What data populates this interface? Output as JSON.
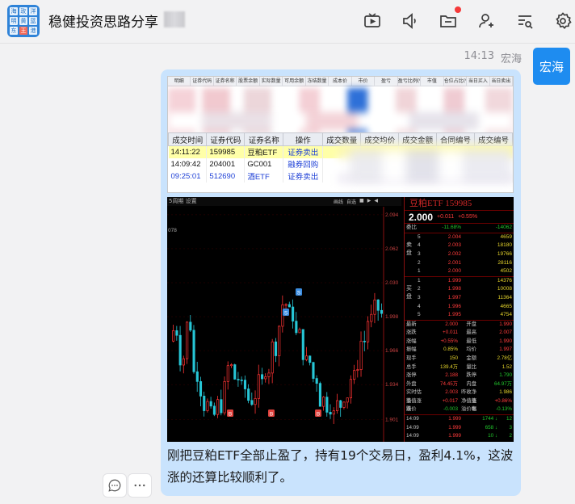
{
  "header": {
    "title": "稳健投资思路分享",
    "avatar_chars": [
      "海",
      "玫",
      "洋",
      "明",
      "黄",
      "蓝",
      "东",
      "王",
      "港"
    ]
  },
  "message": {
    "time": "14:13",
    "sender": "宏海",
    "sender_avatar_text": "宏海",
    "text": "刚把豆粕ETF全部止盈了，持有19个交易日，盈利4.1%，这波涨的还算比较顺利了。"
  },
  "terminal": {
    "top_headers": [
      "明细",
      "证券代码",
      "证券名称",
      "股票余额",
      "实际数量",
      "可用余额",
      "冻结数量",
      "成本价",
      "市价",
      "盈亏",
      "盈亏比例(%)",
      "市值",
      "仓位占比(%)",
      "当日买入",
      "当日卖出"
    ],
    "trade_headers": [
      "成交时间",
      "证券代码",
      "证券名称",
      "操作",
      "成交数量",
      "成交均价",
      "成交金额",
      "合同编号",
      "成交编号"
    ],
    "trades": [
      {
        "time": "14:11:22",
        "code": "159985",
        "name": "豆粕ETF",
        "op": "证券卖出"
      },
      {
        "time": "14:09:42",
        "code": "204001",
        "name": "GC001",
        "op": "融券回购"
      },
      {
        "time": "09:25:01",
        "code": "512690",
        "name": "酒ETF",
        "op": "证券卖出"
      }
    ]
  },
  "chart": {
    "topbar_left": "5周期 设置",
    "tools": [
      "画线",
      "自选",
      "■",
      "▶",
      "◀"
    ],
    "left_tick": "078",
    "ytick_labels": [
      "2.094",
      "2.062",
      "2.030",
      "1.998",
      "1.966",
      "1.934",
      "1.901"
    ],
    "markers": [
      "S",
      "S",
      "B",
      "B",
      "B"
    ]
  },
  "chart_data": {
    "type": "candlestick",
    "title": "",
    "ylim": [
      1.89,
      2.1
    ],
    "y_ticks": [
      2.094,
      2.062,
      2.03,
      1.998,
      1.966,
      1.934,
      1.901
    ]
  },
  "quote": {
    "title": "豆粕ETF 159985",
    "price": "2.000",
    "change": "+0.011",
    "change_pct": "+0.55%",
    "weibi_label": "委比",
    "weibi_value": "-11.68%",
    "weicha_value": "-14062",
    "ask_label": "卖盘",
    "bid_label": "买盘",
    "asks": [
      {
        "level": "5",
        "price": "2.004",
        "vol": "4659"
      },
      {
        "level": "4",
        "price": "2.003",
        "vol": "18180"
      },
      {
        "level": "3",
        "price": "2.002",
        "vol": "19766"
      },
      {
        "level": "2",
        "price": "2.001",
        "vol": "28116"
      },
      {
        "level": "1",
        "price": "2.000",
        "vol": "4502"
      }
    ],
    "bids": [
      {
        "level": "1",
        "price": "1.999",
        "vol": "14376"
      },
      {
        "level": "2",
        "price": "1.998",
        "vol": "10008"
      },
      {
        "level": "3",
        "price": "1.997",
        "vol": "11364"
      },
      {
        "level": "4",
        "price": "1.996",
        "vol": "4665"
      },
      {
        "level": "5",
        "price": "1.995",
        "vol": "4754"
      }
    ],
    "stats": [
      {
        "k1": "最新",
        "v1": "2.000",
        "c1": "red",
        "k2": "开盘",
        "v2": "1.990",
        "c2": "red"
      },
      {
        "k1": "涨跌",
        "v1": "+0.011",
        "c1": "red",
        "k2": "最高",
        "v2": "2.007",
        "c2": "red"
      },
      {
        "k1": "涨幅",
        "v1": "+0.55%",
        "c1": "red",
        "k2": "最低",
        "v2": "1.990",
        "c2": "red"
      },
      {
        "k1": "振幅",
        "v1": "0.85%",
        "c1": "yellow",
        "k2": "均价",
        "v2": "1.997",
        "c2": "red"
      },
      {
        "k1": "现手",
        "v1": "150",
        "c1": "yellow",
        "k2": "金额",
        "v2": "2.78亿",
        "c2": "yellow"
      },
      {
        "k1": "总手",
        "v1": "139.4万",
        "c1": "yellow",
        "k2": "量比",
        "v2": "1.52",
        "c2": "yellow"
      },
      {
        "k1": "涨停",
        "v1": "2.188",
        "c1": "red",
        "k2": "跌停",
        "v2": "1.790",
        "c2": "green"
      },
      {
        "k1": "外盘",
        "v1": "74.45万",
        "c1": "red",
        "k2": "内盘",
        "v2": "64.97万",
        "c2": "green"
      },
      {
        "k1": "实时估值",
        "v1": "2.003",
        "c1": "red",
        "k2": "昨收净值",
        "v2": "1.986",
        "c2": "yellow"
      },
      {
        "k1": "净值涨跌",
        "v1": "+0.017",
        "c1": "red",
        "k2": "净值涨幅",
        "v2": "+0.86%",
        "c2": "red"
      },
      {
        "k1": "溢价",
        "v1": "-0.003",
        "c1": "green",
        "k2": "溢价率",
        "v2": "-0.13%",
        "c2": "green"
      }
    ],
    "ticks": [
      {
        "t": "14:09",
        "p": "1.999",
        "v": "1744",
        "c": "green",
        "extra": "12"
      },
      {
        "t": "14:09",
        "p": "1.999",
        "v": "658",
        "c": "green",
        "extra": "3"
      },
      {
        "t": "14:09",
        "p": "1.999",
        "v": "10",
        "c": "green",
        "extra": "2"
      }
    ]
  },
  "colors": {
    "bubble": "#c9e3fd",
    "accent": "#1e8cf0",
    "up": "#ff3b3b",
    "down": "#21c72c"
  },
  "icons": [
    "tv-icon",
    "speaker-icon",
    "folder-icon",
    "add-user-icon",
    "search-list-icon",
    "gear-icon",
    "comment-icon",
    "more-icon"
  ]
}
